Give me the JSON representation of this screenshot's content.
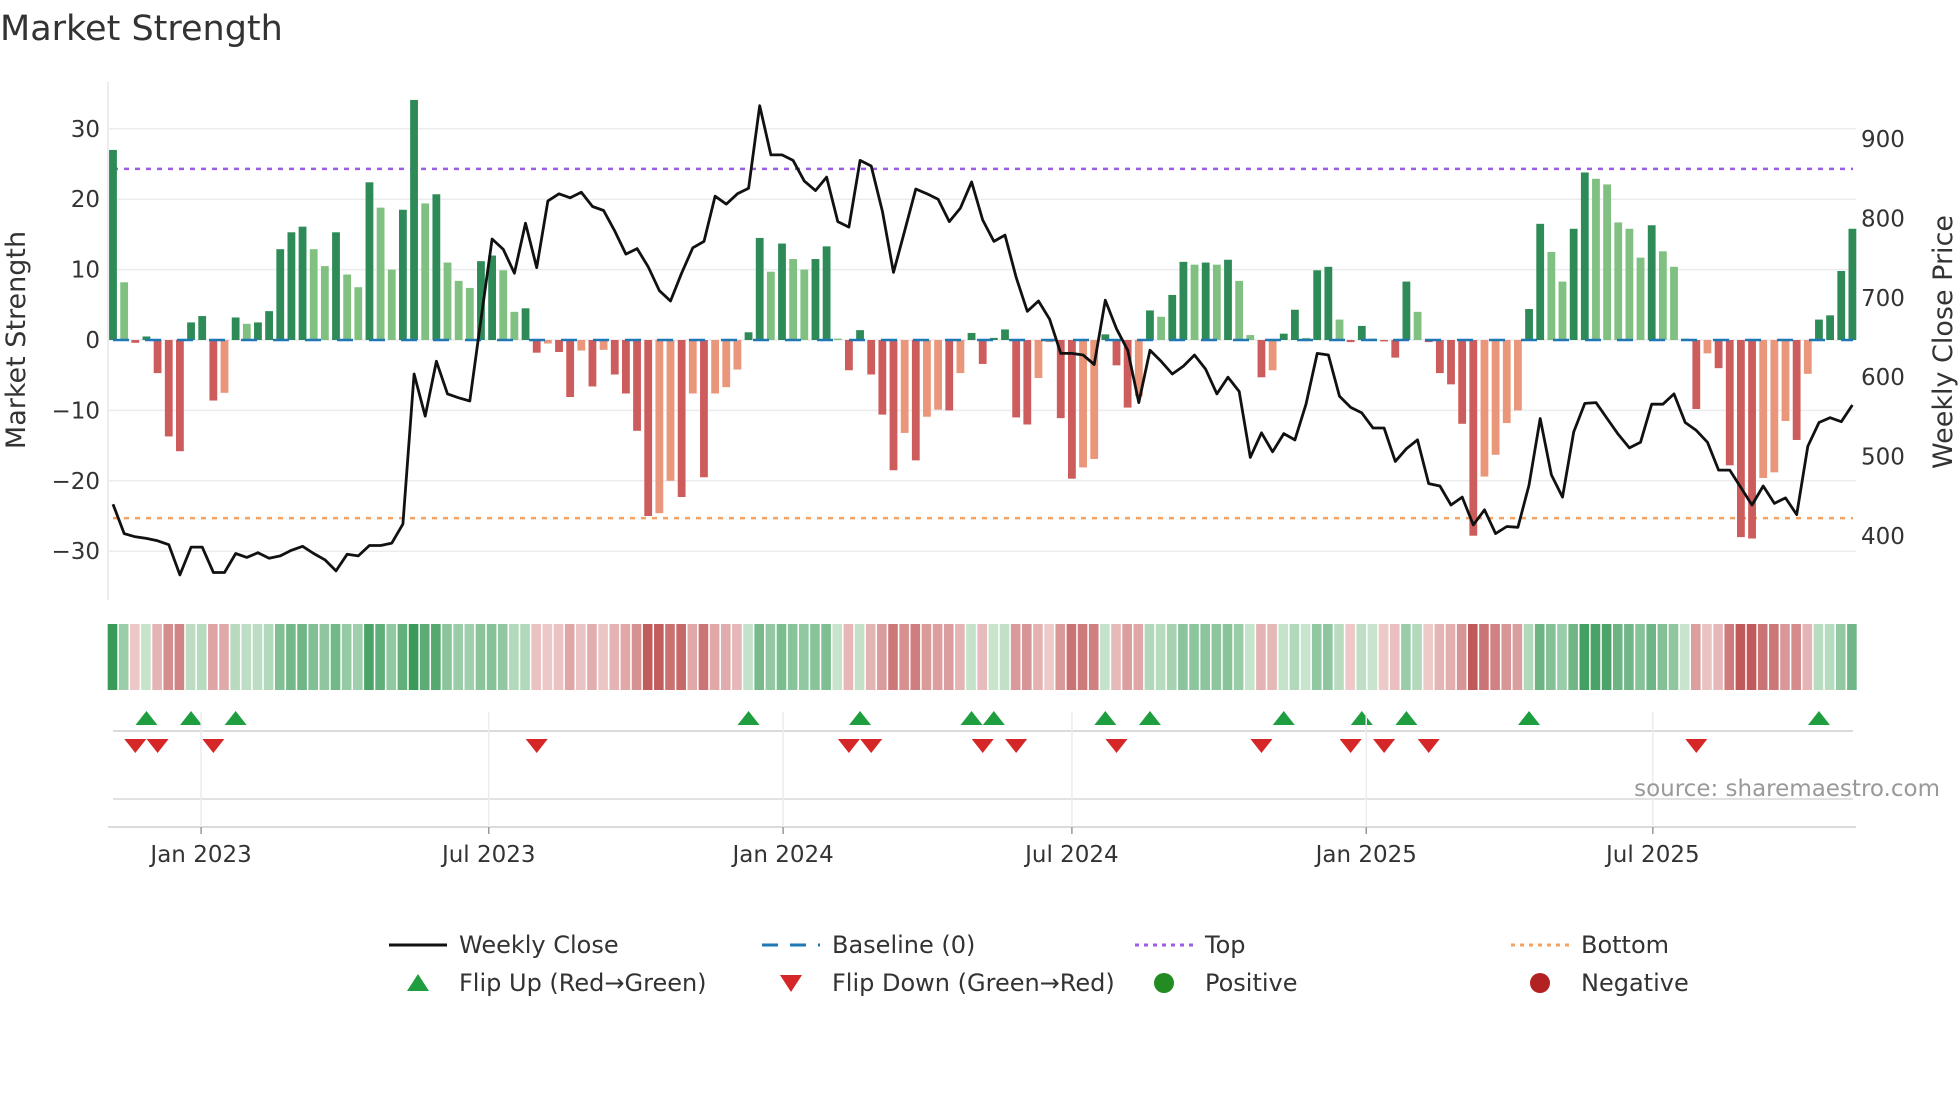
{
  "chart_data": {
    "type": "bar",
    "title": "Market Strength",
    "ylabel": "Market Strength",
    "y2label": "Weekly Close Price",
    "ylim": [
      -37,
      37
    ],
    "y2lim": [
      319,
      972
    ],
    "yticks": [
      "30",
      "20",
      "10",
      "0",
      "−10",
      "−20",
      "−30"
    ],
    "ytick_values": [
      30,
      20,
      10,
      0,
      -10,
      -20,
      -30
    ],
    "y2ticks": [
      "900",
      "800",
      "700",
      "600",
      "500",
      "400"
    ],
    "y2tick_values": [
      900,
      800,
      700,
      600,
      500,
      400
    ],
    "xticks": [
      "Jan 2023",
      "Jul 2023",
      "Jan 2024",
      "Jul 2024",
      "Jan 2025",
      "Jul 2025"
    ],
    "top_level": 24.3,
    "bottom_level": -25.3,
    "grid": true,
    "strength": [
      27.0,
      8.2,
      -0.4,
      0.5,
      -4.7,
      -13.7,
      -15.8,
      2.5,
      3.4,
      -8.6,
      -7.5,
      3.2,
      2.3,
      2.5,
      4.1,
      12.9,
      15.3,
      16.1,
      12.9,
      10.5,
      15.3,
      9.3,
      7.5,
      22.4,
      18.8,
      10.0,
      18.5,
      34.1,
      19.4,
      20.7,
      11.0,
      8.4,
      7.4,
      11.2,
      12.0,
      9.9,
      4.0,
      4.5,
      -1.8,
      -0.5,
      -1.7,
      -8.1,
      -1.5,
      -6.6,
      -1.4,
      -4.9,
      -7.6,
      -12.9,
      -25.0,
      -24.6,
      -20.0,
      -22.3,
      -7.6,
      -19.5,
      -7.6,
      -6.7,
      -4.2,
      1.1,
      14.5,
      9.7,
      13.7,
      11.5,
      10.0,
      11.5,
      13.3,
      0.2,
      -4.3,
      1.4,
      -4.9,
      -10.6,
      -18.5,
      -13.2,
      -17.1,
      -10.9,
      -9.9,
      -10.0,
      -4.7,
      1.0,
      -3.4,
      0.3,
      1.5,
      -11.0,
      -12.0,
      -5.4,
      -0.3,
      -11.1,
      -19.7,
      -18.1,
      -16.9,
      0.8,
      -3.6,
      -9.6,
      -8.0,
      4.2,
      3.3,
      6.4,
      11.1,
      10.7,
      11.0,
      10.7,
      11.4,
      8.4,
      0.7,
      -5.3,
      -4.3,
      0.9,
      4.3,
      0.3,
      9.9,
      10.4,
      2.9,
      -0.3,
      2.0,
      0.2,
      -0.2,
      -2.5,
      8.3,
      4.0,
      -0.3,
      -4.7,
      -6.3,
      -11.9,
      -27.8,
      -19.4,
      -16.3,
      -11.8,
      -10.0,
      4.4,
      16.5,
      12.5,
      8.3,
      15.8,
      23.8,
      22.9,
      22.1,
      16.7,
      15.8,
      11.7,
      16.3,
      12.6,
      10.4,
      0.2,
      -9.8,
      -1.9,
      -4.0,
      -17.8,
      -28.0,
      -28.2,
      -19.6,
      -18.8,
      -11.5,
      -14.2,
      -4.8,
      2.9,
      3.5,
      9.8,
      15.8
    ],
    "weekly_close": [
      440,
      403,
      399,
      397,
      394,
      389,
      351,
      386,
      386,
      354,
      354,
      378,
      373,
      379,
      372,
      375,
      382,
      387,
      378,
      370,
      356,
      377,
      375,
      388,
      388,
      391,
      415,
      604,
      551,
      620,
      579,
      574,
      570,
      672,
      774,
      761,
      731,
      794,
      738,
      822,
      831,
      826,
      833,
      815,
      810,
      784,
      755,
      762,
      739,
      709,
      696,
      731,
      763,
      771,
      828,
      818,
      831,
      838,
      942,
      880,
      880,
      873,
      847,
      835,
      852,
      796,
      789,
      873,
      866,
      809,
      732,
      784,
      837,
      831,
      824,
      796,
      813,
      846,
      798,
      771,
      779,
      726,
      683,
      696,
      673,
      630,
      630,
      628,
      616,
      697,
      661,
      634,
      568,
      634,
      620,
      604,
      614,
      628,
      610,
      579,
      600,
      582,
      499,
      530,
      506,
      529,
      521,
      566,
      630,
      628,
      576,
      562,
      555,
      536,
      536,
      494,
      510,
      521,
      466,
      463,
      439,
      449,
      414,
      433,
      403,
      412,
      411,
      464,
      548,
      477,
      449,
      531,
      567,
      568,
      548,
      528,
      511,
      518,
      566,
      566,
      579,
      543,
      533,
      518,
      483,
      483,
      461,
      439,
      463,
      441,
      448,
      427,
      513,
      543,
      549,
      544,
      565
    ],
    "legend": [
      {
        "label": "Weekly Close",
        "kind": "line",
        "color": "#111111"
      },
      {
        "label": "Baseline (0)",
        "kind": "dash",
        "color": "#1f77b4"
      },
      {
        "label": "Top",
        "kind": "dot",
        "color": "#9b5de5"
      },
      {
        "label": "Bottom",
        "kind": "dot",
        "color": "#f4a261"
      },
      {
        "label": "Flip Up (Red→Green)",
        "kind": "tri-up",
        "color": "#1e9e3e"
      },
      {
        "label": "Flip Down (Green→Red)",
        "kind": "tri-down",
        "color": "#d62728"
      },
      {
        "label": "Positive",
        "kind": "circle",
        "color": "#228b22"
      },
      {
        "label": "Negative",
        "kind": "circle",
        "color": "#b22222"
      }
    ],
    "legend_placement": "bottom",
    "colors": {
      "pos_strong": "#2e8b57",
      "pos_weak": "#80c080",
      "neg_strong": "#cd5c5c",
      "neg_weak": "#e9967a"
    }
  },
  "source": "source: sharemaestro.com"
}
